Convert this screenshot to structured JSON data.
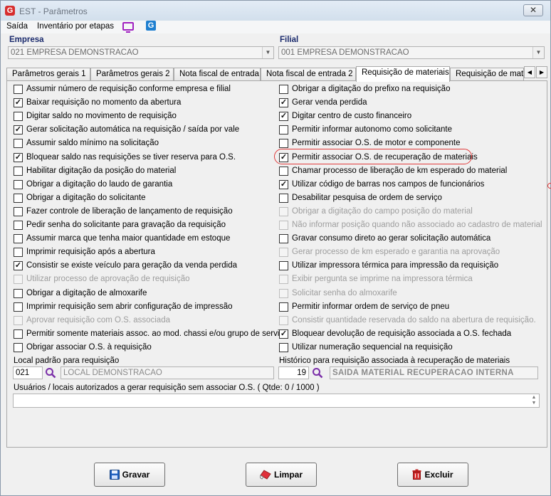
{
  "window": {
    "title": "EST - Parâmetros",
    "close_glyph": "✕"
  },
  "menu": {
    "items": [
      "Saída",
      "Inventário por etapas"
    ],
    "icon_a": "monitor-icon",
    "icon_b": "g-logo-icon"
  },
  "empresa": {
    "label": "Empresa",
    "value": "021 EMPRESA DEMONSTRACAO"
  },
  "filial": {
    "label": "Filial",
    "value": "001 EMPRESA DEMONSTRACAO"
  },
  "tabs": [
    {
      "label": "Parâmetros gerais 1"
    },
    {
      "label": "Parâmetros gerais 2"
    },
    {
      "label": "Nota fiscal de entrada"
    },
    {
      "label": "Nota fiscal de entrada 2"
    },
    {
      "label": "Requisição de materiais",
      "active": true
    },
    {
      "label": "Requisição de materi"
    }
  ],
  "left_options": [
    {
      "label": "Assumir número de requisição conforme empresa e filial",
      "checked": false,
      "enabled": true
    },
    {
      "label": "Baixar requisição no momento da abertura",
      "checked": true,
      "enabled": true
    },
    {
      "label": "Digitar saldo no movimento de requisição",
      "checked": false,
      "enabled": true
    },
    {
      "label": "Gerar solicitação automática na requisição / saída por vale",
      "checked": true,
      "enabled": true
    },
    {
      "label": "Assumir saldo mínimo na solicitação",
      "checked": false,
      "enabled": true
    },
    {
      "label": "Bloquear saldo nas requisições se tiver reserva para O.S.",
      "checked": true,
      "enabled": true
    },
    {
      "label": "Habilitar digitação da posição do material",
      "checked": false,
      "enabled": true
    },
    {
      "label": "Obrigar a digitação do laudo de garantia",
      "checked": false,
      "enabled": true
    },
    {
      "label": "Obrigar a digitação do solicitante",
      "checked": false,
      "enabled": true
    },
    {
      "label": "Fazer controle de liberação de lançamento de requisição",
      "checked": false,
      "enabled": true
    },
    {
      "label": "Pedir senha do solicitante para gravação da requisição",
      "checked": false,
      "enabled": true
    },
    {
      "label": "Assumir marca que tenha maior quantidade em estoque",
      "checked": false,
      "enabled": true
    },
    {
      "label": "Imprimir requisição após a abertura",
      "checked": false,
      "enabled": true
    },
    {
      "label": "Consistir se existe veículo para geração da venda perdida",
      "checked": true,
      "enabled": true
    },
    {
      "label": "Utilizar processo de aprovação de requisição",
      "checked": false,
      "enabled": false
    },
    {
      "label": "Obrigar a digitação de almoxarife",
      "checked": false,
      "enabled": true
    },
    {
      "label": "Imprimir requisição sem abrir configuração de impressão",
      "checked": false,
      "enabled": true
    },
    {
      "label": "Aprovar requisição com O.S. associada",
      "checked": false,
      "enabled": false
    },
    {
      "label": "Permitir somente materiais assoc. ao mod. chassi e/ou grupo de serviço",
      "checked": false,
      "enabled": true
    },
    {
      "label": "Obrigar associar O.S. à requisição",
      "checked": false,
      "enabled": true
    }
  ],
  "right_options": [
    {
      "label": "Obrigar a digitação do prefixo na requisição",
      "checked": false,
      "enabled": true
    },
    {
      "label": "Gerar venda perdida",
      "checked": true,
      "enabled": true
    },
    {
      "label": "Digitar centro de custo financeiro",
      "checked": true,
      "enabled": true
    },
    {
      "label": "Permitir informar autonomo como solicitante",
      "checked": false,
      "enabled": true
    },
    {
      "label": "Permitir associar O.S. de motor e componente",
      "checked": false,
      "enabled": true
    },
    {
      "label": "Permitir associar O.S. de recuperação de materiais",
      "checked": true,
      "enabled": true
    },
    {
      "label": "Chamar processo de liberação de km esperado do material",
      "checked": false,
      "enabled": true
    },
    {
      "label": "Utilizar código de barras nos campos de funcionários",
      "checked": true,
      "enabled": true
    },
    {
      "label": "Desabilitar pesquisa de ordem de serviço",
      "checked": false,
      "enabled": true
    },
    {
      "label": "Obrigar a digitação do campo posição do material",
      "checked": false,
      "enabled": false
    },
    {
      "label": "Não informar posição quando não associado ao cadastro de material",
      "checked": false,
      "enabled": false
    },
    {
      "label": "Gravar consumo direto ao gerar solicitação automática",
      "checked": false,
      "enabled": true
    },
    {
      "label": "Gerar processo de km esperado e garantia na aprovação",
      "checked": false,
      "enabled": false
    },
    {
      "label": "Utilizar impressora térmica para impressão da requisição",
      "checked": false,
      "enabled": true
    },
    {
      "label": "Exibir pergunta se imprime na impressora térmica",
      "checked": false,
      "enabled": false
    },
    {
      "label": "Solicitar senha do almoxarife",
      "checked": false,
      "enabled": false
    },
    {
      "label": "Permitir informar ordem de serviço de pneu",
      "checked": false,
      "enabled": true
    },
    {
      "label": "Consistir quantidade reservada do saldo na abertura de requisição.",
      "checked": false,
      "enabled": false
    },
    {
      "label": "Bloquear devolução de requisição associada a O.S. fechada",
      "checked": true,
      "enabled": true
    },
    {
      "label": "Utilizar numeração sequencial na requisição",
      "checked": false,
      "enabled": true
    }
  ],
  "local": {
    "label": "Local padrão para requisição",
    "code": "021",
    "name": "LOCAL DEMONSTRACAO"
  },
  "historico": {
    "label": "Histórico para requisição associada à recuperação de materiais",
    "code": "19",
    "name": "SAIDA MATERIAL RECUPERACAO INTERNA"
  },
  "usuarios": {
    "label": "Usuários / locais autorizados a gerar requisição sem associar O.S.  ( Qtde: 0 / 1000 )"
  },
  "buttons": {
    "save": "Gravar",
    "clear": "Limpar",
    "delete": "Excluir"
  },
  "colors": {
    "label_blue": "#1a2a6c",
    "highlight_red": "#e03a3a",
    "search_purple": "#7a2ea8"
  }
}
